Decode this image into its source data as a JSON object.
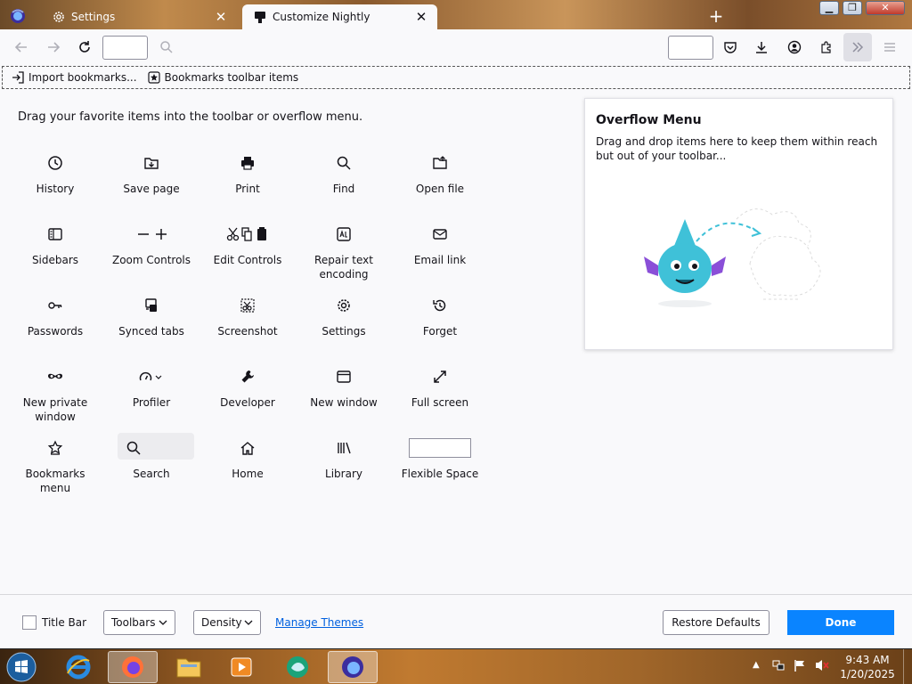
{
  "tabs": [
    {
      "label": "Settings",
      "icon": "gear-icon"
    },
    {
      "label": "Customize Nightly",
      "icon": "customize-icon",
      "active": true
    }
  ],
  "bookmarks": [
    {
      "label": "Import bookmarks...",
      "icon": "import-icon"
    },
    {
      "label": "Bookmarks toolbar items",
      "icon": "star-icon"
    }
  ],
  "palette": {
    "title": "Drag your favorite items into the toolbar or overflow menu.",
    "items": [
      {
        "label": "History",
        "icon": "clock-icon"
      },
      {
        "label": "Save page",
        "icon": "save-page-icon"
      },
      {
        "label": "Print",
        "icon": "printer-icon"
      },
      {
        "label": "Find",
        "icon": "search-icon"
      },
      {
        "label": "Open file",
        "icon": "folder-icon"
      },
      {
        "label": "Sidebars",
        "icon": "sidebar-icon"
      },
      {
        "label": "Zoom Controls",
        "icon": "zoom-icon"
      },
      {
        "label": "Edit Controls",
        "icon": "edit-icon"
      },
      {
        "label": "Repair text encoding",
        "icon": "encoding-icon"
      },
      {
        "label": "Email link",
        "icon": "mail-icon"
      },
      {
        "label": "Passwords",
        "icon": "key-icon"
      },
      {
        "label": "Synced tabs",
        "icon": "synced-tabs-icon"
      },
      {
        "label": "Screenshot",
        "icon": "screenshot-icon"
      },
      {
        "label": "Settings",
        "icon": "gear-icon"
      },
      {
        "label": "Forget",
        "icon": "forget-icon"
      },
      {
        "label": "New private window",
        "icon": "mask-icon"
      },
      {
        "label": "Profiler",
        "icon": "profiler-icon"
      },
      {
        "label": "Developer",
        "icon": "wrench-icon"
      },
      {
        "label": "New window",
        "icon": "window-icon"
      },
      {
        "label": "Full screen",
        "icon": "fullscreen-icon"
      },
      {
        "label": "Bookmarks menu",
        "icon": "bookmark-star-icon"
      },
      {
        "label": "Search",
        "icon": "search-icon"
      },
      {
        "label": "Home",
        "icon": "home-icon"
      },
      {
        "label": "Library",
        "icon": "library-icon"
      },
      {
        "label": "Flexible Space",
        "icon": "flexible-space-icon"
      }
    ]
  },
  "overflow": {
    "title": "Overflow Menu",
    "description": "Drag and drop items here to keep them within reach but out of your toolbar..."
  },
  "footer": {
    "title_bar": "Title Bar",
    "toolbars": "Toolbars",
    "density": "Density",
    "manage_themes": "Manage Themes",
    "restore_defaults": "Restore Defaults",
    "done": "Done"
  },
  "taskbar": {
    "time": "9:43 AM",
    "date": "1/20/2025"
  },
  "colors": {
    "accent": "#0a84ff",
    "link": "#0060df",
    "mascot": "#3fc1d8"
  }
}
